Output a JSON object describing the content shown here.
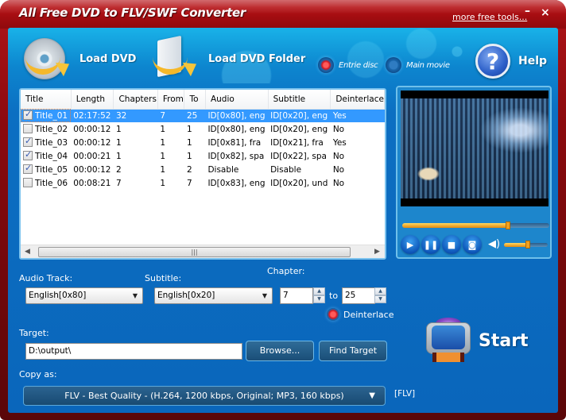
{
  "window": {
    "title": "All Free DVD to FLV/SWF Converter",
    "more_tools_link": "more free tools...",
    "minimize_glyph": "–",
    "close_glyph": "×"
  },
  "toolbar": {
    "load_dvd": {
      "label": "Load DVD",
      "icon": "disc-arrow-icon"
    },
    "load_dvd_folder": {
      "label": "Load DVD Folder",
      "icon": "folder-arrow-icon"
    },
    "help": {
      "label": "Help",
      "icon": "help-icon",
      "glyph": "?"
    },
    "mode_options": [
      {
        "label": "Entrie disc",
        "selected": true
      },
      {
        "label": "Main movie",
        "selected": false
      }
    ]
  },
  "titles_table": {
    "columns": [
      "Title",
      "Length",
      "Chapters",
      "From",
      "To",
      "Audio",
      "Subtitle",
      "Deinterlace"
    ],
    "rows": [
      {
        "checked": true,
        "selected": true,
        "title": "Title_01",
        "length": "02:17:52",
        "chapters": "32",
        "from": "7",
        "to": "25",
        "audio": "ID[0x80], eng",
        "subtitle": "ID[0x20], eng",
        "deinterlace": "Yes"
      },
      {
        "checked": false,
        "selected": false,
        "title": "Title_02",
        "length": "00:00:12",
        "chapters": "1",
        "from": "1",
        "to": "1",
        "audio": "ID[0x80], eng",
        "subtitle": "ID[0x20], eng",
        "deinterlace": "No"
      },
      {
        "checked": true,
        "selected": false,
        "title": "Title_03",
        "length": "00:00:12",
        "chapters": "1",
        "from": "1",
        "to": "1",
        "audio": "ID[0x81], fra",
        "subtitle": "ID[0x21], fra",
        "deinterlace": "Yes"
      },
      {
        "checked": true,
        "selected": false,
        "title": "Title_04",
        "length": "00:00:21",
        "chapters": "1",
        "from": "1",
        "to": "1",
        "audio": "ID[0x82], spa",
        "subtitle": "ID[0x22], spa",
        "deinterlace": "No"
      },
      {
        "checked": true,
        "selected": false,
        "title": "Title_05",
        "length": "00:00:12",
        "chapters": "2",
        "from": "1",
        "to": "2",
        "audio": "Disable",
        "subtitle": "Disable",
        "deinterlace": "No"
      },
      {
        "checked": false,
        "selected": false,
        "title": "Title_06",
        "length": "00:08:21",
        "chapters": "7",
        "from": "1",
        "to": "7",
        "audio": "ID[0x83], eng",
        "subtitle": "ID[0x20], und",
        "deinterlace": "No"
      }
    ],
    "scrollbar": {
      "left_arrow": "◀",
      "right_arrow": "▶",
      "grip": "|||"
    }
  },
  "player": {
    "seek_position": 0.72,
    "volume": 0.55,
    "controls": [
      {
        "name": "play-button",
        "glyph": "▶"
      },
      {
        "name": "pause-button",
        "glyph": "❚❚"
      },
      {
        "name": "stop-button",
        "glyph": "■"
      },
      {
        "name": "snapshot-button",
        "glyph": "◙"
      }
    ],
    "volume_glyph": "◀)"
  },
  "settings": {
    "audio_track": {
      "label": "Audio Track:",
      "value": "English[0x80]"
    },
    "subtitle": {
      "label": "Subtitle:",
      "value": "English[0x20]"
    },
    "chapter": {
      "label": "Chapter:",
      "from": "7",
      "to_label": "to",
      "to": "25"
    },
    "deinterlace": {
      "label": "Deinterlace",
      "checked": true
    },
    "dropdown_glyph": "▼",
    "spin_up": "▲",
    "spin_down": "▼"
  },
  "target": {
    "label": "Target:",
    "value": "D:\\output\\",
    "browse_label": "Browse...",
    "find_label": "Find Target"
  },
  "copy_as": {
    "label": "Copy as:",
    "value": "FLV - Best Quality - (H.264, 1200 kbps, Original; MP3, 160 kbps)",
    "format_tag": "[FLV]"
  },
  "start": {
    "label": "Start"
  }
}
